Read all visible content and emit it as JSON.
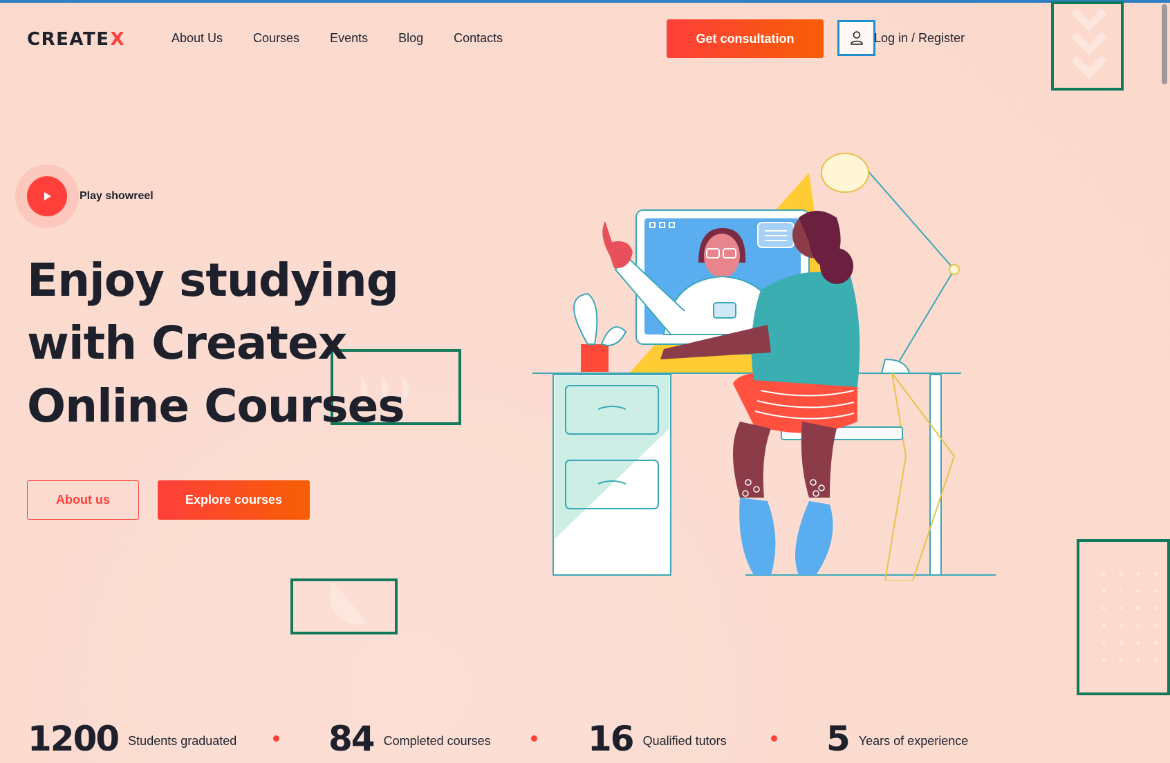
{
  "header": {
    "logo_text": "CREATE",
    "logo_x": "X",
    "nav": [
      {
        "label": "About Us"
      },
      {
        "label": "Courses"
      },
      {
        "label": "Events"
      },
      {
        "label": "Blog"
      },
      {
        "label": "Contacts"
      }
    ],
    "consult_label": "Get consultation",
    "login_label": "Log in / Register",
    "login_icon": "user-icon"
  },
  "hero": {
    "play_label": "Play showreel",
    "play_icon": "play-icon",
    "title_lines": [
      "Enjoy studying",
      "with Createx",
      "Online Courses"
    ],
    "about_button": "About us",
    "explore_button": "Explore courses"
  },
  "stats": [
    {
      "number": "1200",
      "label": "Students graduated"
    },
    {
      "number": "84",
      "label": "Completed courses"
    },
    {
      "number": "16",
      "label": "Qualified tutors"
    },
    {
      "number": "5",
      "label": "Years of experience"
    }
  ],
  "colors": {
    "accent": "#ff3f3a",
    "accent_gradient_end": "#f75e05",
    "background": "#fcdcd0",
    "text": "#1e212c",
    "annotation_green": "#13795b",
    "annotation_blue": "#1e8fc9"
  }
}
